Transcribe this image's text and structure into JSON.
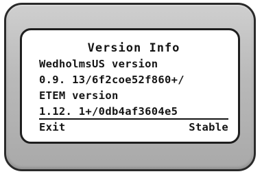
{
  "screen": {
    "title": "Version Info",
    "lines": [
      "WedholmsUS version",
      "0.9. 13/6f2coe52f860+/",
      "ETEM version",
      "1.12. 1+/0db4af3604e5"
    ]
  },
  "softkeys": {
    "left": "Exit",
    "right": "Stable"
  },
  "colors": {
    "bezel": "#b9b9b9",
    "screen": "#ffffff",
    "text": "#141414"
  }
}
